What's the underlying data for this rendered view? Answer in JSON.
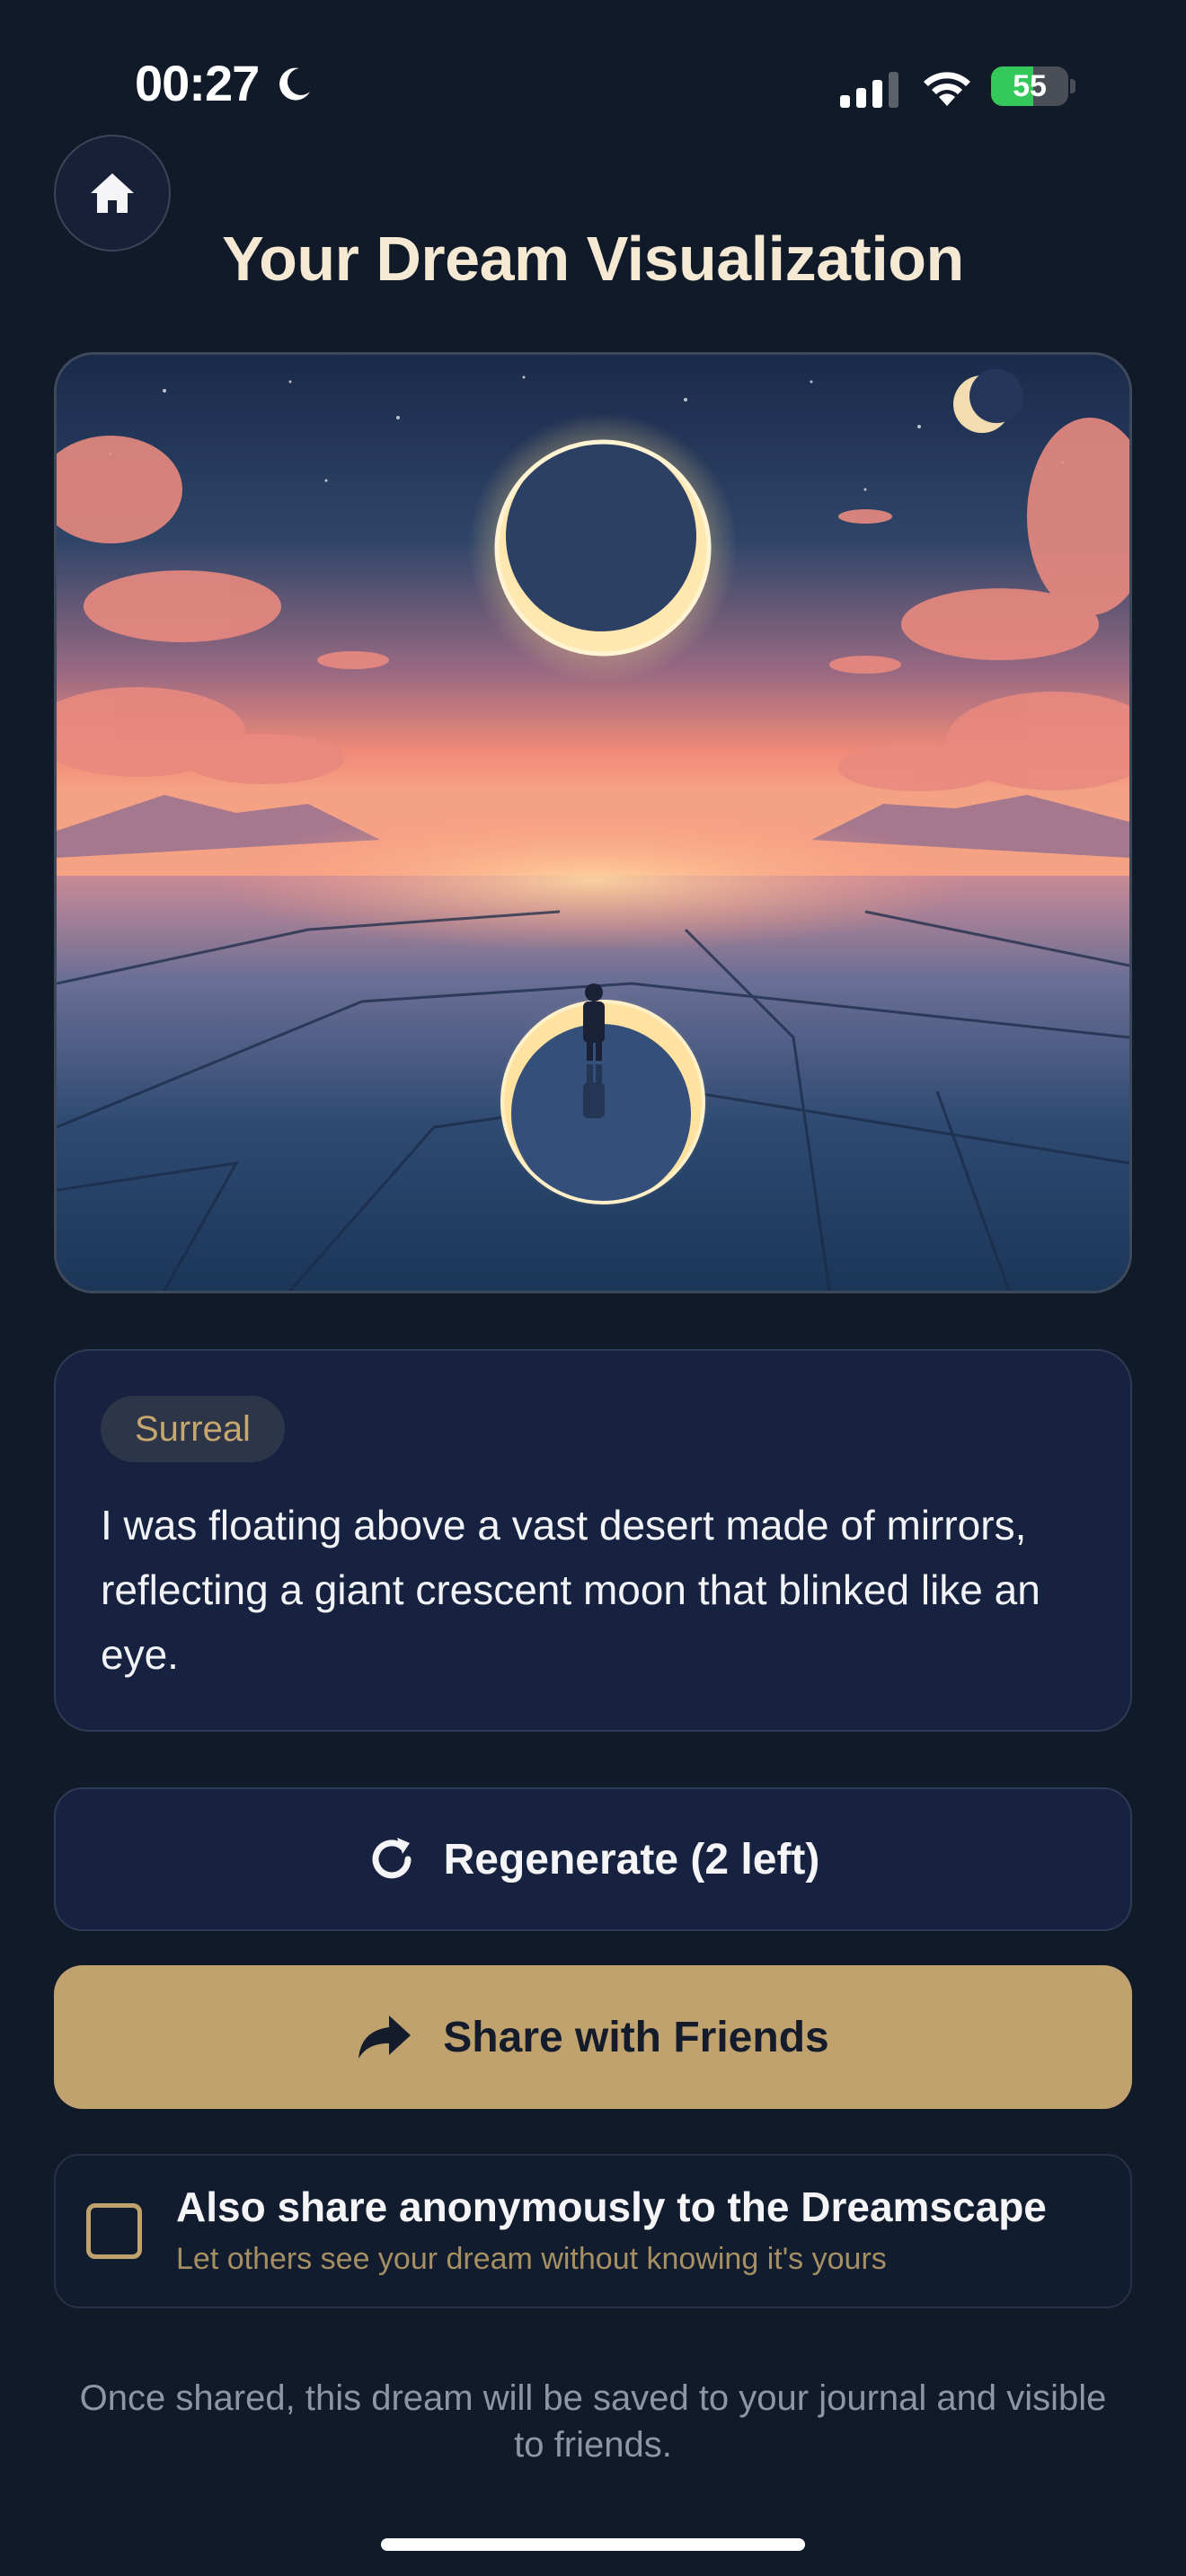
{
  "status_bar": {
    "time": "00:27",
    "battery_percent": "55",
    "battery_level": 0.55,
    "icons": [
      "moon-icon",
      "signal-icon",
      "wifi-icon",
      "battery-icon"
    ]
  },
  "header": {
    "home_icon": "home-icon",
    "title": "Your Dream Visualization"
  },
  "dream": {
    "image_alt_icon": "dream-image",
    "tag": "Surreal",
    "text": "I was floating above a vast desert made of mirrors, reflecting a giant crescent moon that blinked like an eye."
  },
  "actions": {
    "regenerate_label": "Regenerate (2 left)",
    "regenerate_icon": "refresh-icon",
    "share_label": "Share with Friends",
    "share_icon": "share-arrow-icon"
  },
  "anonymous_share": {
    "checked": false,
    "title": "Also share anonymously to the Dreamscape",
    "subtitle": "Let others see your dream without knowing it's yours"
  },
  "footer": {
    "note": "Once shared, this dream will be saved to your journal and visible to friends."
  },
  "colors": {
    "background": "#101a29",
    "card": "#162240",
    "accent_gold": "#bfa26d",
    "title": "#f5e9d4",
    "battery_green": "#34c759"
  }
}
